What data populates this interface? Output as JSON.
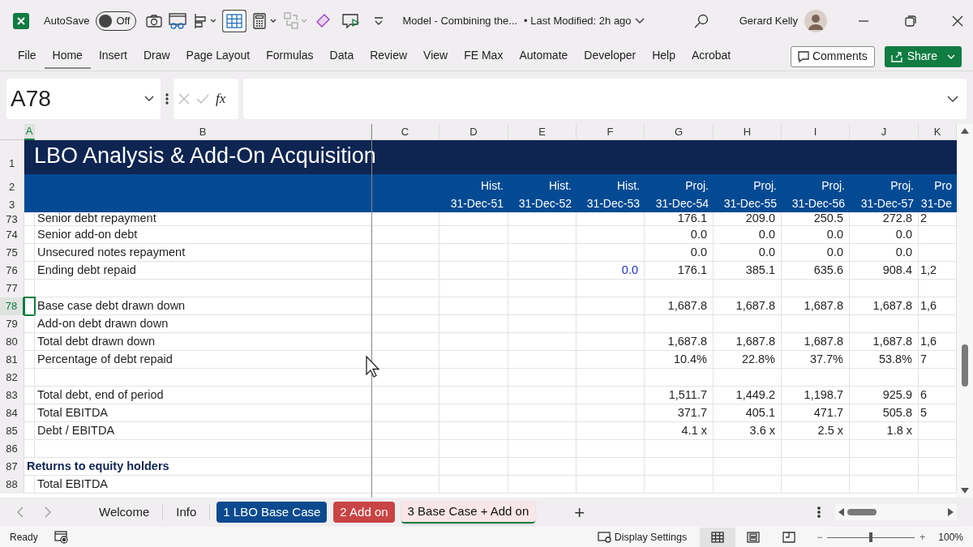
{
  "title_bar": {
    "autosave_label": "AutoSave",
    "autosave_on": false,
    "autosave_state": "Off",
    "document": "Model - Combining the...",
    "modified": "• Last Modified: 2h ago",
    "user": "Gerard Kelly"
  },
  "ribbon_tabs": [
    {
      "label": "File",
      "selected": false
    },
    {
      "label": "Home",
      "selected": true
    },
    {
      "label": "Insert",
      "selected": false
    },
    {
      "label": "Draw",
      "selected": false
    },
    {
      "label": "Page Layout",
      "selected": false
    },
    {
      "label": "Formulas",
      "selected": false
    },
    {
      "label": "Data",
      "selected": false
    },
    {
      "label": "Review",
      "selected": false
    },
    {
      "label": "View",
      "selected": false
    },
    {
      "label": "FE Max",
      "selected": false
    },
    {
      "label": "Automate",
      "selected": false
    },
    {
      "label": "Developer",
      "selected": false
    },
    {
      "label": "Help",
      "selected": false
    },
    {
      "label": "Acrobat",
      "selected": false
    }
  ],
  "ribbon_buttons": {
    "comments": "Comments",
    "share": "Share"
  },
  "formula_bar": {
    "name_box": "A78",
    "fx": "fx"
  },
  "columns": [
    {
      "label": "A",
      "selected": true
    },
    {
      "label": "B",
      "selected": false
    },
    {
      "label": "C",
      "selected": false
    },
    {
      "label": "D",
      "selected": false
    },
    {
      "label": "E",
      "selected": false
    },
    {
      "label": "F",
      "selected": false
    },
    {
      "label": "G",
      "selected": false
    },
    {
      "label": "H",
      "selected": false
    },
    {
      "label": "I",
      "selected": false
    },
    {
      "label": "J",
      "selected": false
    },
    {
      "label": "K",
      "selected": false
    }
  ],
  "sheet_title": {
    "row": "1",
    "text": "LBO Analysis & Add-On Acquisition"
  },
  "period_rows": [
    {
      "row": "2",
      "cells": [
        "Hist.",
        "Hist.",
        "Hist.",
        "Proj.",
        "Proj.",
        "Proj.",
        "Proj.",
        "Pro"
      ]
    },
    {
      "row": "3",
      "cells": [
        "31-Dec-51",
        "31-Dec-52",
        "31-Dec-53",
        "31-Dec-54",
        "31-Dec-55",
        "31-Dec-56",
        "31-Dec-57",
        "31-De"
      ]
    }
  ],
  "rows": [
    {
      "row": "73",
      "label": "Senior debt repayment",
      "kind": "item",
      "selected": false,
      "cells": [
        {
          "kind": "empty"
        },
        {
          "kind": "empty"
        },
        {
          "kind": "empty"
        },
        {
          "kind": "empty"
        },
        {
          "kind": "formula",
          "text": "176.1"
        },
        {
          "kind": "formula",
          "text": "209.0"
        },
        {
          "kind": "formula",
          "text": "250.5"
        },
        {
          "kind": "formula",
          "text": "272.8"
        },
        {
          "kind": "formula",
          "text": "2"
        }
      ]
    },
    {
      "row": "74",
      "label": "Senior add-on debt",
      "kind": "item",
      "selected": false,
      "cells": [
        {
          "kind": "empty"
        },
        {
          "kind": "empty"
        },
        {
          "kind": "empty"
        },
        {
          "kind": "empty"
        },
        {
          "kind": "formula",
          "text": "0.0"
        },
        {
          "kind": "formula",
          "text": "0.0"
        },
        {
          "kind": "formula",
          "text": "0.0"
        },
        {
          "kind": "formula",
          "text": "0.0"
        },
        {
          "kind": "empty"
        }
      ]
    },
    {
      "row": "75",
      "label": "Unsecured notes repayment",
      "kind": "item",
      "selected": false,
      "cells": [
        {
          "kind": "empty"
        },
        {
          "kind": "empty"
        },
        {
          "kind": "empty"
        },
        {
          "kind": "empty"
        },
        {
          "kind": "formula",
          "text": "0.0"
        },
        {
          "kind": "formula",
          "text": "0.0"
        },
        {
          "kind": "formula",
          "text": "0.0"
        },
        {
          "kind": "formula",
          "text": "0.0"
        },
        {
          "kind": "empty"
        }
      ]
    },
    {
      "row": "76",
      "label": "Ending debt repaid",
      "kind": "item",
      "selected": false,
      "cells": [
        {
          "kind": "empty"
        },
        {
          "kind": "empty"
        },
        {
          "kind": "empty"
        },
        {
          "kind": "input",
          "text": "0.0"
        },
        {
          "kind": "formula",
          "text": "176.1"
        },
        {
          "kind": "formula",
          "text": "385.1"
        },
        {
          "kind": "formula",
          "text": "635.6"
        },
        {
          "kind": "formula",
          "text": "908.4"
        },
        {
          "kind": "formula",
          "text": "1,2"
        }
      ]
    },
    {
      "row": "77",
      "kind": "blank",
      "selected": false
    },
    {
      "row": "78",
      "label": "Base case debt drawn down",
      "kind": "item",
      "selected": true,
      "cells": [
        {
          "kind": "empty"
        },
        {
          "kind": "empty"
        },
        {
          "kind": "empty"
        },
        {
          "kind": "empty"
        },
        {
          "kind": "formula",
          "text": "1,687.8"
        },
        {
          "kind": "formula",
          "text": "1,687.8"
        },
        {
          "kind": "formula",
          "text": "1,687.8"
        },
        {
          "kind": "formula",
          "text": "1,687.8"
        },
        {
          "kind": "formula",
          "text": "1,6"
        }
      ]
    },
    {
      "row": "79",
      "label": "Add-on debt drawn down",
      "kind": "item",
      "selected": false
    },
    {
      "row": "80",
      "label": "Total debt drawn down",
      "kind": "item",
      "selected": false,
      "cells": [
        {
          "kind": "empty"
        },
        {
          "kind": "empty"
        },
        {
          "kind": "empty"
        },
        {
          "kind": "empty"
        },
        {
          "kind": "formula",
          "text": "1,687.8"
        },
        {
          "kind": "formula",
          "text": "1,687.8"
        },
        {
          "kind": "formula",
          "text": "1,687.8"
        },
        {
          "kind": "formula",
          "text": "1,687.8"
        },
        {
          "kind": "formula",
          "text": "1,6"
        }
      ]
    },
    {
      "row": "81",
      "label": "Percentage of debt repaid",
      "kind": "item",
      "selected": false,
      "cells": [
        {
          "kind": "empty"
        },
        {
          "kind": "empty"
        },
        {
          "kind": "empty"
        },
        {
          "kind": "empty"
        },
        {
          "kind": "formula",
          "text": "10.4%"
        },
        {
          "kind": "formula",
          "text": "22.8%"
        },
        {
          "kind": "formula",
          "text": "37.7%"
        },
        {
          "kind": "formula",
          "text": "53.8%"
        },
        {
          "kind": "formula",
          "text": "7"
        }
      ]
    },
    {
      "row": "82",
      "kind": "blank",
      "selected": false
    },
    {
      "row": "83",
      "label": "Total debt, end of period",
      "kind": "item",
      "selected": false,
      "cells": [
        {
          "kind": "empty"
        },
        {
          "kind": "empty"
        },
        {
          "kind": "empty"
        },
        {
          "kind": "empty"
        },
        {
          "kind": "formula",
          "text": "1,511.7"
        },
        {
          "kind": "formula",
          "text": "1,449.2"
        },
        {
          "kind": "formula",
          "text": "1,198.7"
        },
        {
          "kind": "formula",
          "text": "925.9"
        },
        {
          "kind": "formula",
          "text": "6"
        }
      ]
    },
    {
      "row": "84",
      "label": "Total EBITDA",
      "kind": "item",
      "selected": false,
      "cells": [
        {
          "kind": "empty"
        },
        {
          "kind": "empty"
        },
        {
          "kind": "empty"
        },
        {
          "kind": "empty"
        },
        {
          "kind": "formula",
          "text": "371.7"
        },
        {
          "kind": "formula",
          "text": "405.1"
        },
        {
          "kind": "formula",
          "text": "471.7"
        },
        {
          "kind": "formula",
          "text": "505.8"
        },
        {
          "kind": "formula",
          "text": "5"
        }
      ]
    },
    {
      "row": "85",
      "label": "Debt / EBITDA",
      "kind": "item",
      "selected": false,
      "cells": [
        {
          "kind": "empty"
        },
        {
          "kind": "empty"
        },
        {
          "kind": "empty"
        },
        {
          "kind": "empty"
        },
        {
          "kind": "formula",
          "text": "4.1 x"
        },
        {
          "kind": "formula",
          "text": "3.6 x"
        },
        {
          "kind": "formula",
          "text": "2.5 x"
        },
        {
          "kind": "formula",
          "text": "1.8 x"
        },
        {
          "kind": "empty"
        }
      ]
    },
    {
      "row": "86",
      "kind": "blank",
      "selected": false
    },
    {
      "row": "87",
      "label": "Returns to equity holders",
      "kind": "section",
      "selected": false
    },
    {
      "row": "88",
      "label": "Total EBITDA",
      "kind": "item",
      "selected": false
    }
  ],
  "sheet_tabs": [
    {
      "label": "Welcome",
      "selected": false
    },
    {
      "label": "Info",
      "selected": false
    },
    {
      "label": "1 LBO Base Case",
      "selected": false,
      "color": "#0b4a8f"
    },
    {
      "label": "2 Add on",
      "selected": false,
      "color": "#c94444"
    },
    {
      "label": "3 Base Case + Add on",
      "selected": true
    }
  ],
  "add_sheet": "+",
  "status_bar": {
    "ready": "Ready",
    "display_settings": "Display Settings",
    "views": [
      {
        "kind": "normal",
        "selected": true
      },
      {
        "kind": "page-layout",
        "selected": false
      },
      {
        "kind": "page-break",
        "selected": false
      }
    ],
    "zoom": {
      "level": 0.5
    },
    "zoom_minus": "−",
    "zoom_plus": "+",
    "zoom_text": "100%"
  }
}
